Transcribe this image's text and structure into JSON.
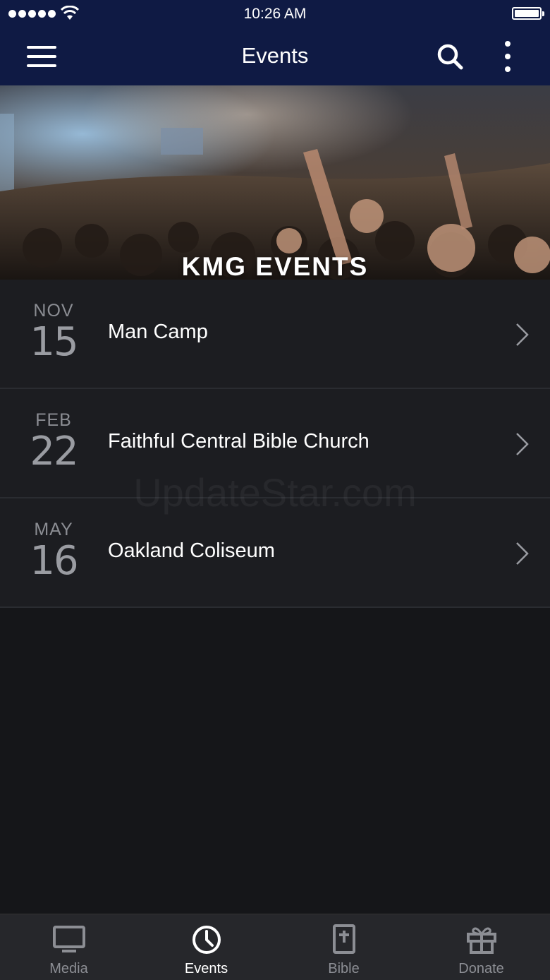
{
  "status_bar": {
    "time": "10:26 AM"
  },
  "nav": {
    "title": "Events"
  },
  "hero": {
    "title": "KMG EVENTS"
  },
  "events": [
    {
      "month": "NOV",
      "day": "15",
      "title": "Man Camp"
    },
    {
      "month": "FEB",
      "day": "22",
      "title": "Faithful Central Bible Church"
    },
    {
      "month": "MAY",
      "day": "16",
      "title": "Oakland Coliseum"
    }
  ],
  "watermark": "UpdateStar.com",
  "tabs": [
    {
      "label": "Media",
      "icon": "tv-icon"
    },
    {
      "label": "Events",
      "icon": "clock-icon",
      "active": true
    },
    {
      "label": "Bible",
      "icon": "bible-icon"
    },
    {
      "label": "Donate",
      "icon": "gift-icon"
    }
  ],
  "colors": {
    "nav_bg": "#0f1a44",
    "page_bg": "#151619",
    "row_bg": "#1c1d21",
    "tab_bg": "#26272b"
  }
}
